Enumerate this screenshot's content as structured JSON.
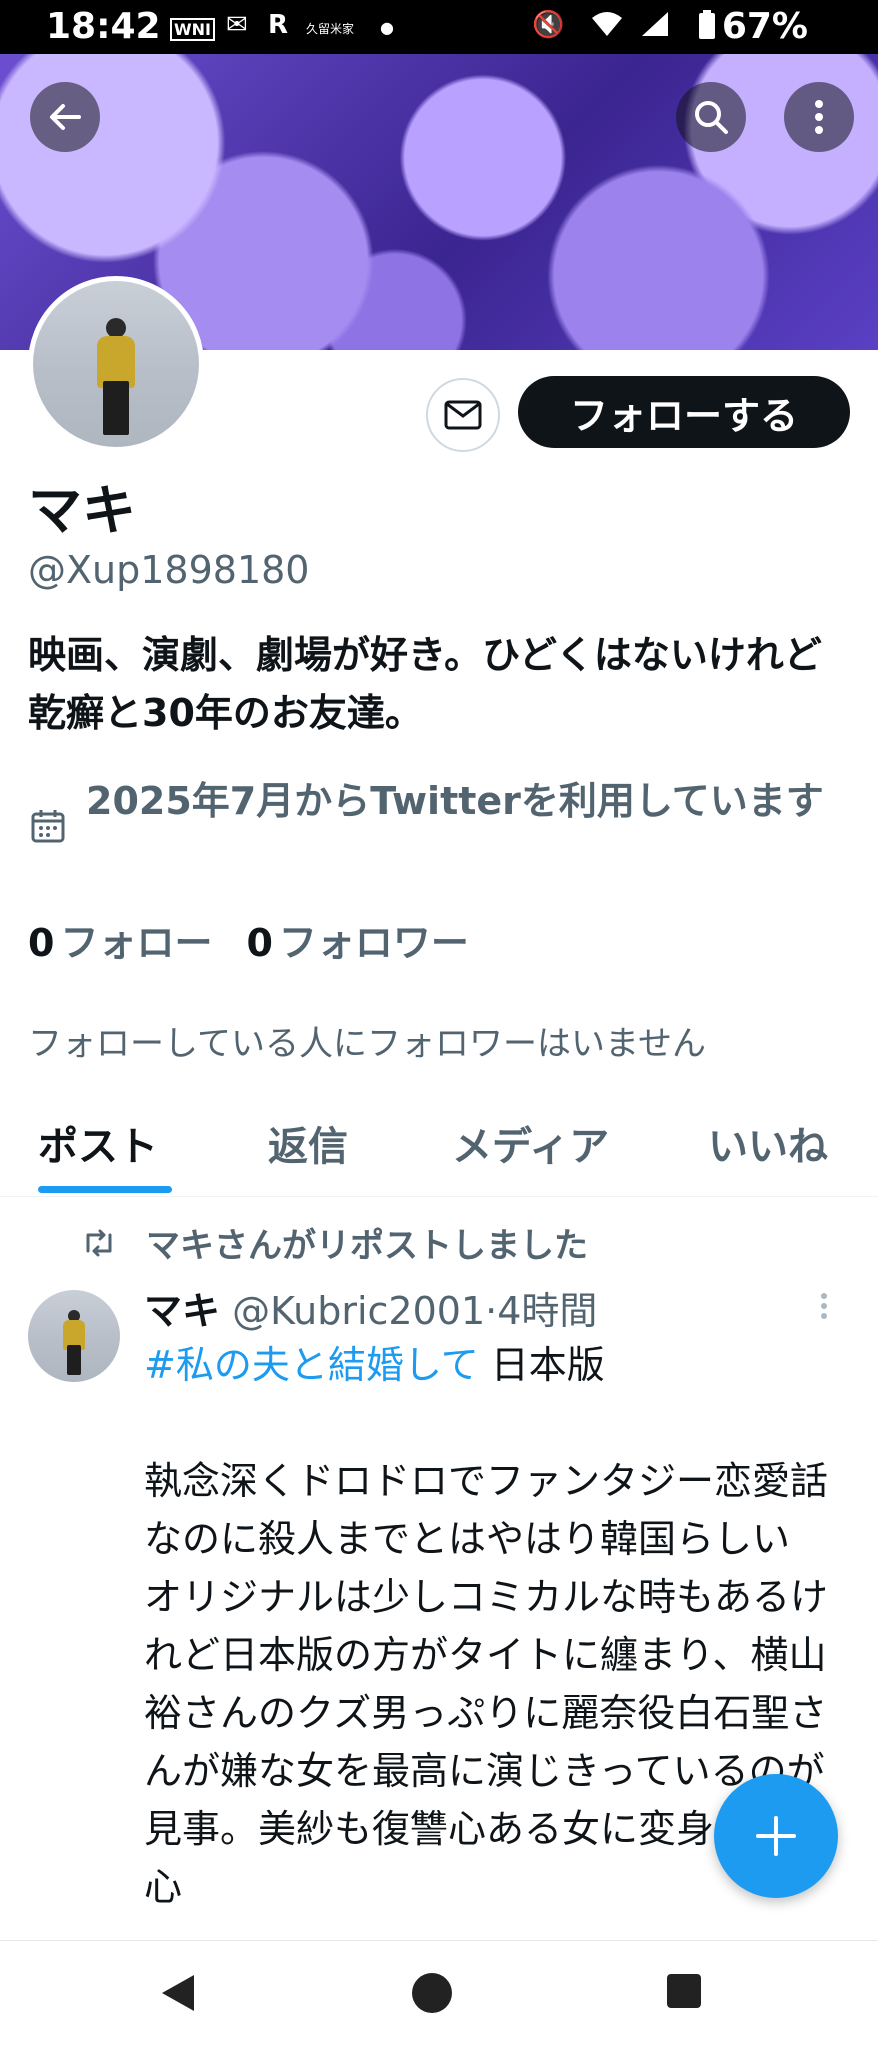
{
  "status_bar": {
    "time": "18:42",
    "notif_icons": [
      "WNI",
      "R",
      "久留米家"
    ],
    "battery": "67%"
  },
  "profile": {
    "name": "マキ",
    "handle": "@Xup1898180",
    "bio": "映画、演劇、劇場が好き。ひどくはないけれど乾癬と30年のお友達。",
    "joined": "2025年7月からTwitterを利用しています",
    "following_count": "0",
    "following_label": "フォロー",
    "followers_count": "0",
    "followers_label": "フォロワー",
    "not_followed_notice": "フォローしている人にフォロワーはいません",
    "follow_button": "フォローする"
  },
  "tabs": [
    {
      "label": "ポスト",
      "active": true
    },
    {
      "label": "返信",
      "active": false
    },
    {
      "label": "メディア",
      "active": false
    },
    {
      "label": "いいね",
      "active": false
    }
  ],
  "post": {
    "repost_notice": "マキさんがリポストしました",
    "author_name": "マキ",
    "author_handle": "@Kubric2001",
    "time": "4時間",
    "hashtag": "#私の夫と結婚して",
    "title_suffix": "日本版",
    "body": "執念深くドロドロでファンタジー恋愛話なのに殺人までとはやはり韓国らしい\nオリジナルは少しコミカルな時もあるけれど日本版の方がタイトに纏まり、横山裕さんのクズ男っぷりに麗奈役白石聖さんが嫌な女を最高に演じきっているのが見事。美紗も復讐心ある女に変身して安心"
  },
  "icons": {
    "back": "arrow-left-icon",
    "search": "search-icon",
    "more": "more-vertical-icon",
    "message": "envelope-icon",
    "calendar": "calendar-icon",
    "repost": "repost-icon",
    "compose": "plus-icon",
    "nav_back": "triangle-back-icon",
    "nav_home": "circle-home-icon",
    "nav_recents": "square-recents-icon"
  },
  "colors": {
    "accent": "#1d9bf0",
    "text": "#0f1419",
    "secondary": "#536471",
    "banner": "#6b4fd0"
  }
}
